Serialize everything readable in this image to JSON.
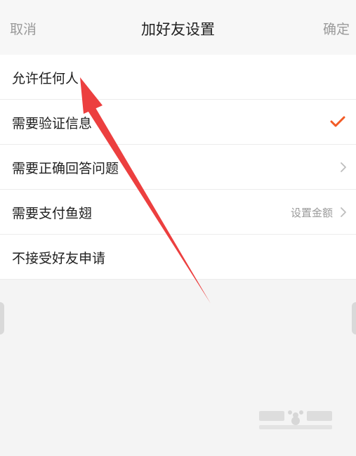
{
  "header": {
    "cancel_label": "取消",
    "title": "加好友设置",
    "confirm_label": "确定"
  },
  "options": [
    {
      "label": "允许任何人"
    },
    {
      "label": "需要验证信息",
      "selected": true
    },
    {
      "label": "需要正确回答问题"
    },
    {
      "label": "需要支付鱼翅",
      "right_text": "设置金额"
    },
    {
      "label": "不接受好友申请"
    }
  ],
  "colors": {
    "accent": "#f25a24",
    "annotation_arrow": "#ec3f3f",
    "chevron": "#bdbdbd"
  }
}
